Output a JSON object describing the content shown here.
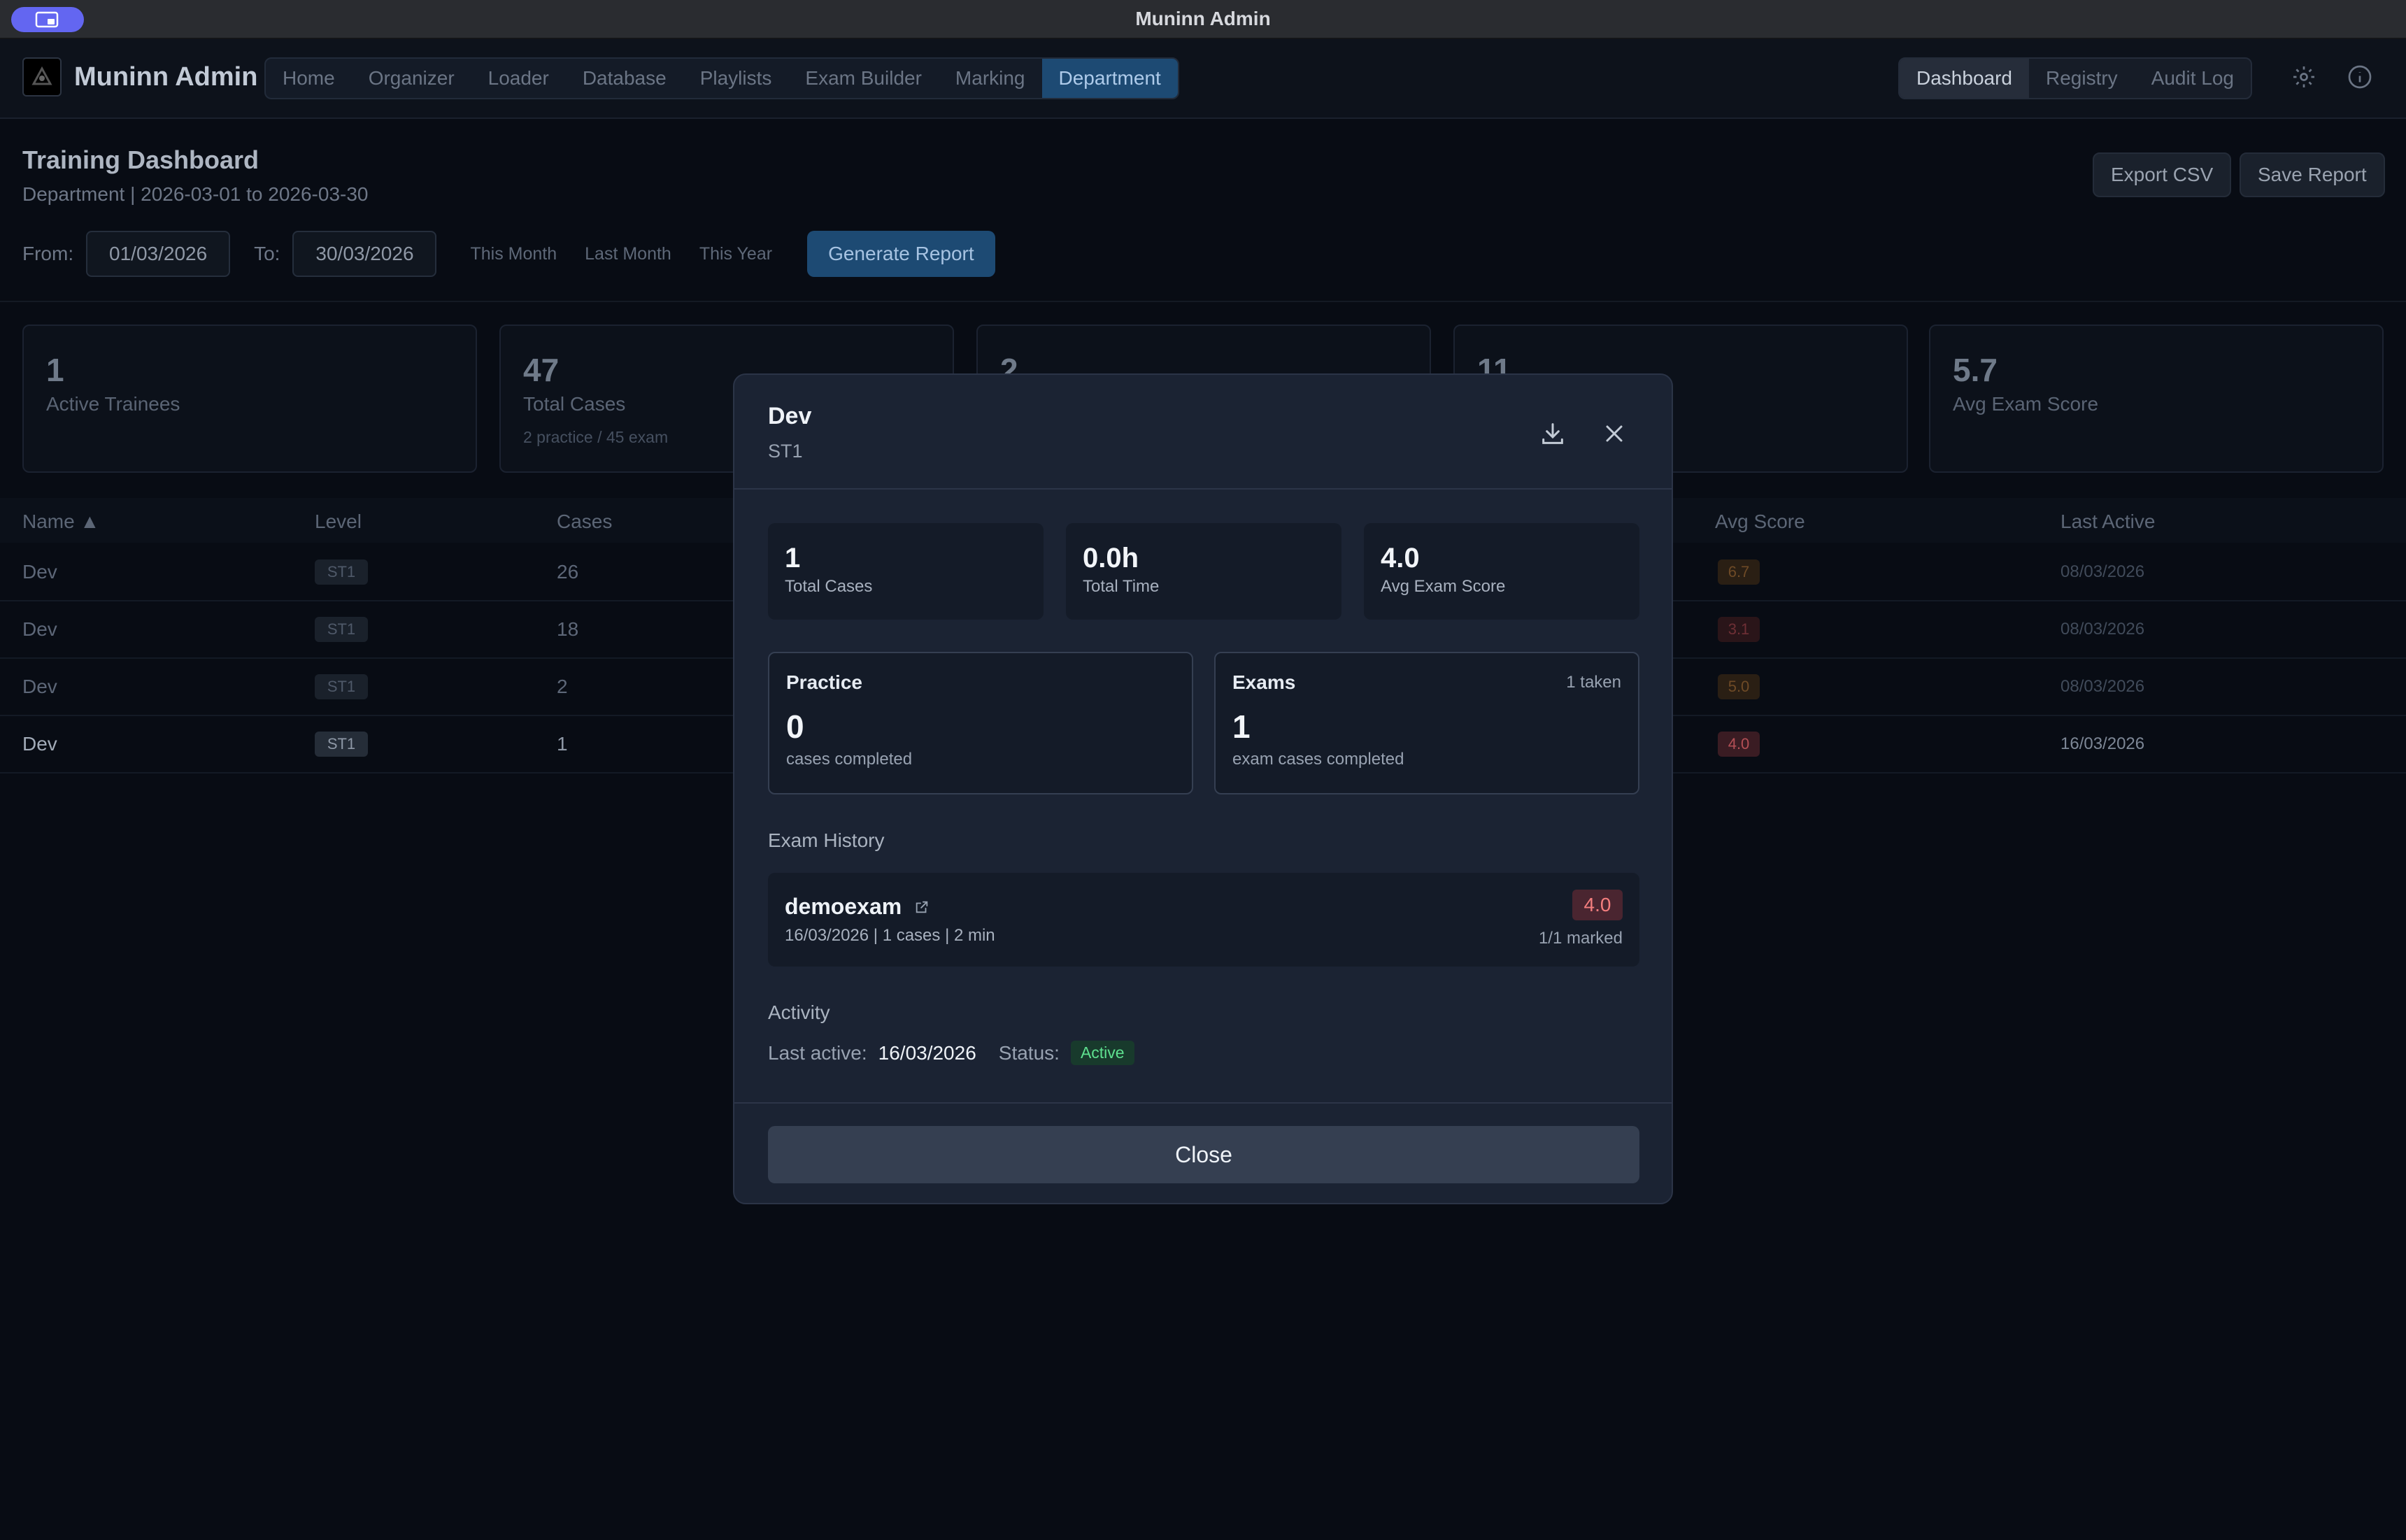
{
  "window": {
    "title": "Muninn Admin"
  },
  "nav": {
    "brand": "Muninn Admin",
    "items": [
      "Home",
      "Organizer",
      "Loader",
      "Database",
      "Playlists",
      "Exam Builder",
      "Marking",
      "Department"
    ],
    "active": "Department",
    "right_tabs": [
      "Dashboard",
      "Registry",
      "Audit Log"
    ],
    "right_active": "Dashboard",
    "icons": [
      "gear-icon",
      "info-icon"
    ]
  },
  "header": {
    "title": "Training Dashboard",
    "subtitle": "Department | 2026-03-01 to 2026-03-30",
    "export_label": "Export CSV",
    "save_label": "Save Report"
  },
  "filters": {
    "from_label": "From:",
    "from_value": "01/03/2026",
    "to_label": "To:",
    "to_value": "30/03/2026",
    "quick": [
      "This Month",
      "Last Month",
      "This Year"
    ],
    "generate_label": "Generate Report"
  },
  "stats": [
    {
      "value": "1",
      "label": "Active Trainees",
      "sub": ""
    },
    {
      "value": "47",
      "label": "Total Cases",
      "sub": "2 practice / 45 exam"
    },
    {
      "value": "2",
      "label": "",
      "sub": ""
    },
    {
      "value": "11",
      "label": "",
      "sub": ""
    },
    {
      "value": "5.7",
      "label": "Avg Exam Score",
      "sub": ""
    }
  ],
  "table": {
    "columns": [
      "Name ▲",
      "Level",
      "Cases",
      "Avg Score",
      "Last Active"
    ],
    "rows": [
      {
        "name": "Dev",
        "level": "ST1",
        "cases": "26",
        "score": "6.7",
        "last": "08/03/2026"
      },
      {
        "name": "Dev",
        "level": "ST1",
        "cases": "18",
        "score": "3.1",
        "last": "08/03/2026"
      },
      {
        "name": "Dev",
        "level": "ST1",
        "cases": "2",
        "score": "5.0",
        "last": "08/03/2026"
      },
      {
        "name": "Dev",
        "level": "ST1",
        "cases": "1",
        "score": "4.0",
        "last": "16/03/2026"
      }
    ]
  },
  "modal": {
    "name": "Dev",
    "level": "ST1",
    "stats": [
      {
        "value": "1",
        "label": "Total Cases"
      },
      {
        "value": "0.0h",
        "label": "Total Time"
      },
      {
        "value": "4.0",
        "label": "Avg Exam Score"
      }
    ],
    "practice": {
      "title": "Practice",
      "count": "0",
      "sub": "cases completed"
    },
    "exams": {
      "title": "Exams",
      "taken": "1 taken",
      "count": "1",
      "sub": "exam cases completed"
    },
    "history_title": "Exam History",
    "history": [
      {
        "name": "demoexam",
        "meta": "16/03/2026 | 1 cases | 2 min",
        "score": "4.0",
        "marked": "1/1 marked"
      }
    ],
    "activity_title": "Activity",
    "last_active_label": "Last active:",
    "last_active_value": "16/03/2026",
    "status_label": "Status:",
    "status_value": "Active",
    "close_label": "Close"
  },
  "colors": {
    "accent": "#1d4a73",
    "danger": "#f47e7e",
    "success": "#5ee08f",
    "warning": "#c9843a"
  }
}
